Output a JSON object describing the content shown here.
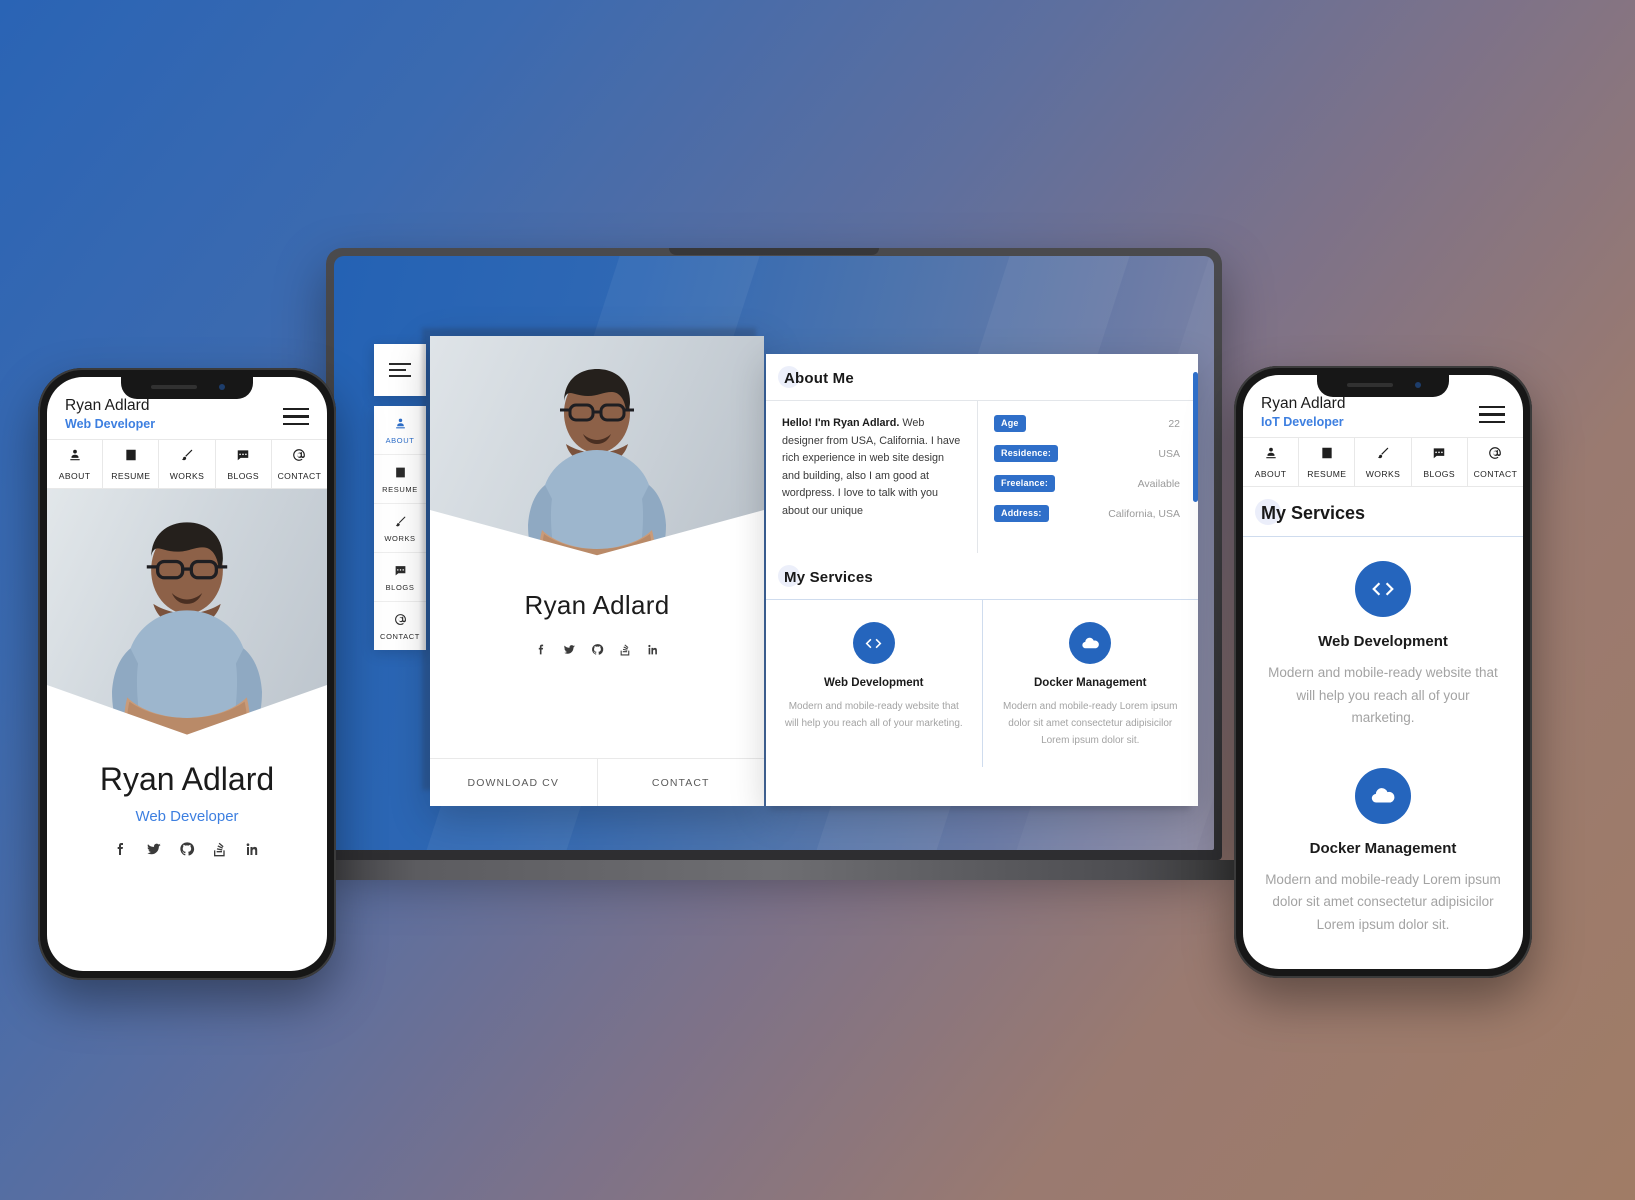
{
  "theme": {
    "accent": "#2565bd",
    "link": "#3d7fe0",
    "bg_start": "#2462b4",
    "bg_end": "#a07c66",
    "badge_bg": "#2f6fc9"
  },
  "laptop": {
    "sidebar": {
      "menu_icon": "hamburger-icon",
      "items": [
        {
          "label": "ABOUT",
          "icon": "user-icon",
          "active": true
        },
        {
          "label": "RESUME",
          "icon": "document-icon",
          "active": false
        },
        {
          "label": "WORKS",
          "icon": "brush-icon",
          "active": false
        },
        {
          "label": "BLOGS",
          "icon": "comment-icon",
          "active": false
        },
        {
          "label": "CONTACT",
          "icon": "at-icon",
          "active": false
        }
      ]
    },
    "profile_card": {
      "name": "Ryan Adlard",
      "socials": [
        "facebook-icon",
        "twitter-icon",
        "github-icon",
        "stackoverflow-icon",
        "linkedin-icon"
      ],
      "actions": [
        {
          "label": "DOWNLOAD CV"
        },
        {
          "label": "CONTACT"
        }
      ]
    },
    "content": {
      "about": {
        "title": "About Me",
        "lead": "Hello! I'm Ryan Adlard.",
        "body": "Web designer from USA, California. I have rich experience in web site design and building, also I am good at wordpress. I love to talk with you about our unique",
        "info": [
          {
            "label": "Age",
            "value": "22"
          },
          {
            "label": "Residence:",
            "value": "USA"
          },
          {
            "label": "Freelance:",
            "value": "Available"
          },
          {
            "label": "Address:",
            "value": "California, USA"
          }
        ]
      },
      "services": {
        "title": "My Services",
        "items": [
          {
            "icon": "code-icon",
            "name": "Web Development",
            "desc": "Modern and mobile-ready website that will help you reach all of your marketing."
          },
          {
            "icon": "cloud-icon",
            "name": "Docker Management",
            "desc": "Modern and mobile-ready Lorem ipsum dolor sit amet consectetur adipisicilor Lorem ipsum dolor sit."
          }
        ]
      }
    }
  },
  "phone_left": {
    "header": {
      "name": "Ryan Adlard",
      "role": "Web Developer",
      "menu_icon": "hamburger-icon"
    },
    "nav": [
      {
        "label": "ABOUT",
        "icon": "user-icon"
      },
      {
        "label": "RESUME",
        "icon": "document-icon"
      },
      {
        "label": "WORKS",
        "icon": "brush-icon"
      },
      {
        "label": "BLOGS",
        "icon": "comment-icon"
      },
      {
        "label": "CONTACT",
        "icon": "at-icon"
      }
    ],
    "profile": {
      "name": "Ryan Adlard",
      "role": "Web Developer",
      "socials": [
        "facebook-icon",
        "twitter-icon",
        "github-icon",
        "stackoverflow-icon",
        "linkedin-icon"
      ]
    }
  },
  "phone_right": {
    "header": {
      "name": "Ryan Adlard",
      "role": "IoT Developer",
      "menu_icon": "hamburger-icon"
    },
    "nav": [
      {
        "label": "ABOUT",
        "icon": "user-icon"
      },
      {
        "label": "RESUME",
        "icon": "document-icon"
      },
      {
        "label": "WORKS",
        "icon": "brush-icon"
      },
      {
        "label": "BLOGS",
        "icon": "comment-icon"
      },
      {
        "label": "CONTACT",
        "icon": "at-icon"
      }
    ],
    "services": {
      "title": "My Services",
      "items": [
        {
          "icon": "code-icon",
          "name": "Web Development",
          "desc": "Modern and mobile-ready website that will help you reach all of your marketing."
        },
        {
          "icon": "cloud-icon",
          "name": "Docker Management",
          "desc": "Modern and mobile-ready Lorem ipsum dolor sit amet consectetur adipisicilor Lorem ipsum dolor sit."
        }
      ]
    }
  }
}
